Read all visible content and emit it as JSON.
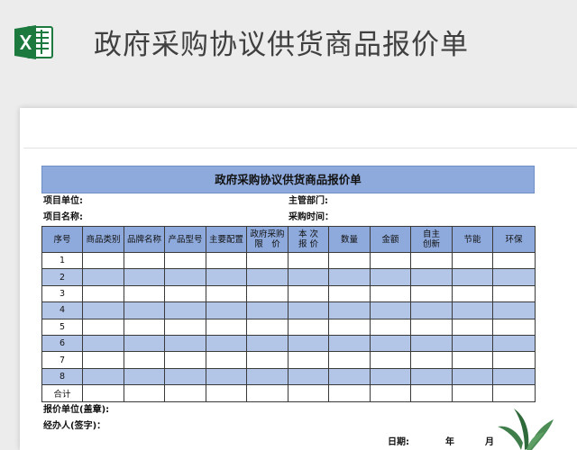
{
  "page_heading": "政府采购协议供货商品报价单",
  "form": {
    "title": "政府采购协议供货商品报价单",
    "project_unit_label": "项目单位:",
    "supervisor_label": "主管部门:",
    "project_name_label": "项目名称:",
    "purchase_time_label": "采购时间：",
    "columns": [
      {
        "line1": "序号",
        "line2": ""
      },
      {
        "line1": "商品类别",
        "line2": ""
      },
      {
        "line1": "品牌名称",
        "line2": ""
      },
      {
        "line1": "产品型号",
        "line2": ""
      },
      {
        "line1": "主要配置",
        "line2": ""
      },
      {
        "line1": "政府采购",
        "line2": "限　价"
      },
      {
        "line1": "本 次",
        "line2": "报 价"
      },
      {
        "line1": "数量",
        "line2": ""
      },
      {
        "line1": "金额",
        "line2": ""
      },
      {
        "line1": "自主",
        "line2": "创新"
      },
      {
        "line1": "节能",
        "line2": ""
      },
      {
        "line1": "环保",
        "line2": ""
      }
    ],
    "rows": [
      "1",
      "2",
      "3",
      "4",
      "5",
      "6",
      "7",
      "8"
    ],
    "total_label": "合计",
    "quote_unit_label": "报价单位(盖章):",
    "handler_label": "经办人(签字)：",
    "date_label": "日期:",
    "year_label": "年",
    "month_label": "月"
  },
  "icons": {
    "app_icon": "excel-icon",
    "decor": "plant-icon"
  },
  "colors": {
    "header_blue": "#8ea9db",
    "band_blue": "#b4c6e7",
    "excel_green": "#1d7a3f"
  }
}
